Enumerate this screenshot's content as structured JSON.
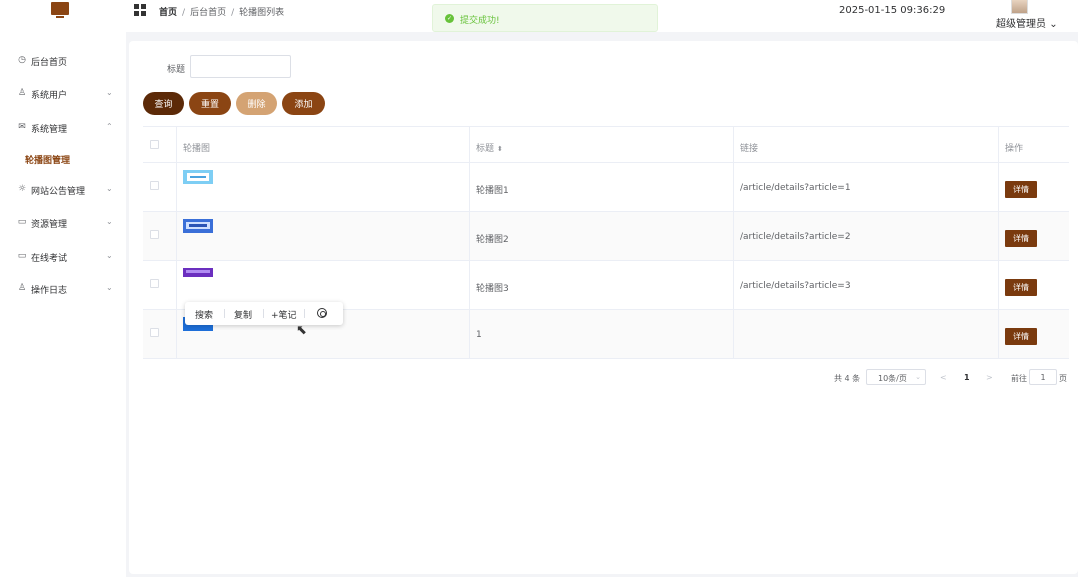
{
  "header": {
    "breadcrumb": [
      "首页",
      "后台首页",
      "轮播图列表"
    ],
    "toast": "提交成功!",
    "datetime": "2025-01-15 09:36:29",
    "user": "超级管理员"
  },
  "sidebar": {
    "items": [
      {
        "label": "后台首页",
        "icon": "clock-icon"
      },
      {
        "label": "系统用户",
        "icon": "user-icon",
        "arrow": "⌄"
      },
      {
        "label": "系统管理",
        "icon": "mail-icon",
        "arrow": "⌃"
      },
      {
        "label": "网站公告管理",
        "icon": "sun-icon",
        "arrow": "⌄"
      },
      {
        "label": "资源管理",
        "icon": "monitor-icon",
        "arrow": "⌄"
      },
      {
        "label": "在线考试",
        "icon": "monitor-icon",
        "arrow": "⌄"
      },
      {
        "label": "操作日志",
        "icon": "user-icon",
        "arrow": "⌄"
      }
    ],
    "active_sub": "轮播图管理"
  },
  "search": {
    "label": "标题",
    "value": ""
  },
  "buttons": {
    "query": "查询",
    "reset": "重置",
    "delete": "删除",
    "add": "添加"
  },
  "colors": {
    "query": "#5c2a08",
    "reset": "#8b4513",
    "delete": "#d4a373",
    "add": "#8b4513"
  },
  "table": {
    "headers": [
      "轮播图",
      "标题",
      "链接",
      "操作"
    ],
    "rows": [
      {
        "title": "轮播图1",
        "link": "/article/details?article=1",
        "action": "详情"
      },
      {
        "title": "轮播图2",
        "link": "/article/details?article=2",
        "action": "详情"
      },
      {
        "title": "轮播图3",
        "link": "/article/details?article=3",
        "action": "详情"
      },
      {
        "title": "1",
        "link": "",
        "action": "详情"
      }
    ]
  },
  "pagination": {
    "total": "共 4 条",
    "page_size": "10条/页",
    "prev": "<",
    "current": "1",
    "next": ">",
    "goto_label": "前往",
    "goto_value": "1",
    "page_unit": "页"
  },
  "popup": {
    "search": "搜索",
    "copy": "复制",
    "note": "+笔记"
  }
}
